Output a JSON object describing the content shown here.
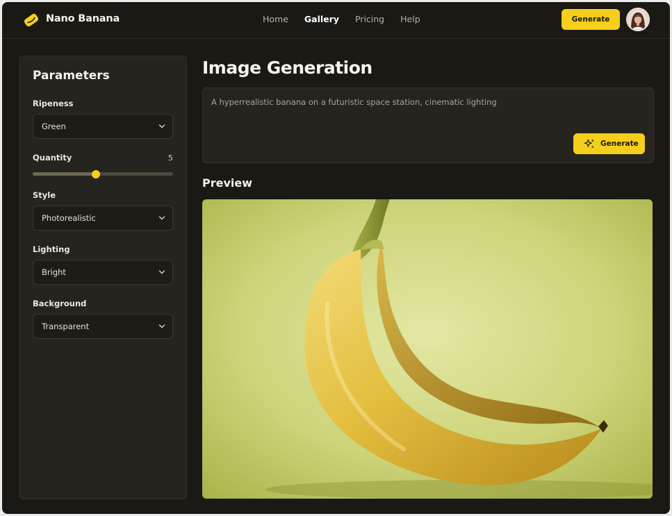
{
  "app": {
    "name": "Nano Banana"
  },
  "nav": {
    "items": [
      {
        "label": "Home",
        "active": false
      },
      {
        "label": "Gallery",
        "active": true
      },
      {
        "label": "Pricing",
        "active": false
      },
      {
        "label": "Help",
        "active": false
      }
    ]
  },
  "header": {
    "generate_label": "Generate"
  },
  "sidebar": {
    "title": "Parameters",
    "ripeness": {
      "label": "Ripeness",
      "value": "Green"
    },
    "quantity": {
      "label": "Quantity",
      "value": "5",
      "level": 0.45
    },
    "style": {
      "label": "Style",
      "value": "Photorealistic"
    },
    "lighting": {
      "label": "Lighting",
      "value": "Bright"
    },
    "background": {
      "label": "Background",
      "value": "Transparent"
    }
  },
  "main": {
    "title": "Image Generation",
    "prompt": "A hyperrealistic banana on a futuristic space station, cinematic lighting",
    "generate_label": "Generate",
    "preview_title": "Preview"
  },
  "colors": {
    "accent": "#f5cf1c",
    "background": "#1a1914",
    "panel": "#25241e"
  },
  "icons": {
    "logo": "banana-logo-icon",
    "dropdown": "chevron-down-icon",
    "generate": "sparkles-icon",
    "avatar": "user-avatar"
  }
}
